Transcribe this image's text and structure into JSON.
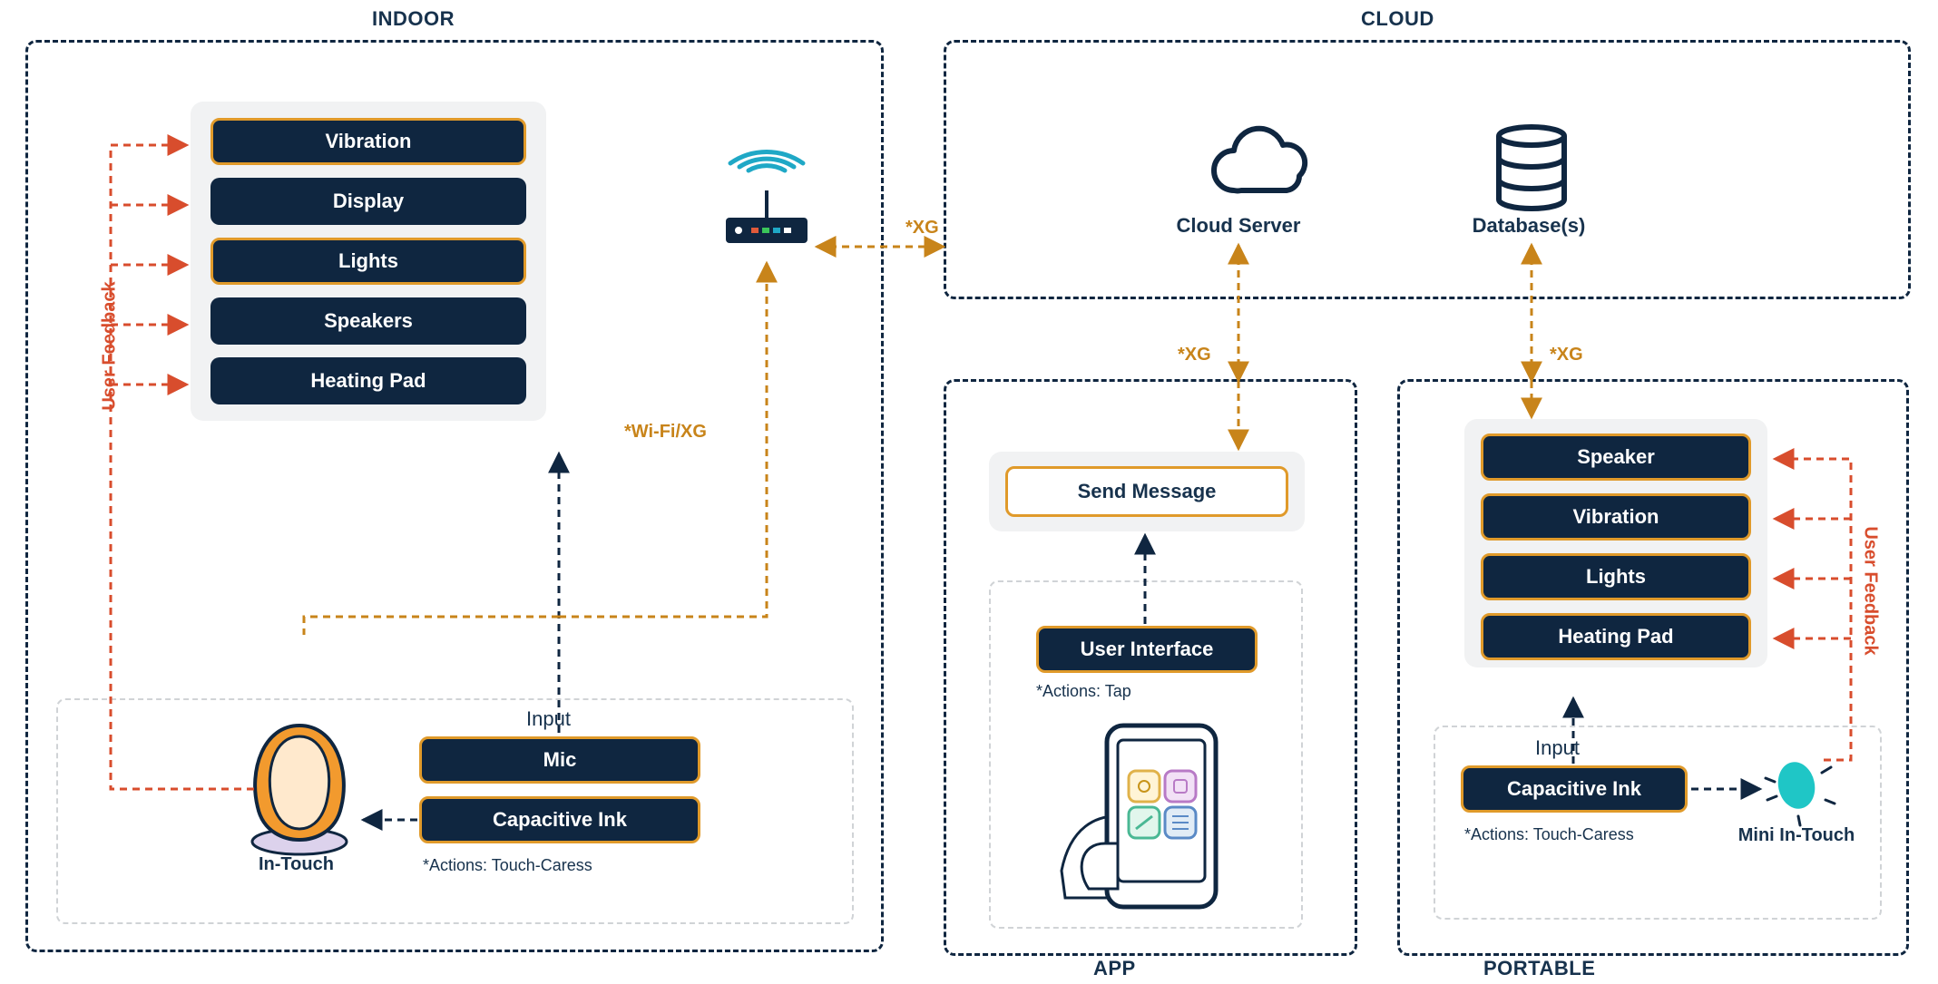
{
  "sections": {
    "indoor": "INDOOR",
    "cloud": "CLOUD",
    "app": "APP",
    "portable": "PORTABLE"
  },
  "indoor": {
    "outputs": [
      "Vibration",
      "Display",
      "Lights",
      "Speakers",
      "Heating Pad"
    ],
    "input_title": "Input",
    "inputs": [
      "Mic",
      "Capacitive Ink"
    ],
    "device_label": "In-Touch",
    "actions_note": "*Actions: Touch-Caress",
    "wifi_label": "*Wi-Fi/XG",
    "feedback_label": "User Feedback"
  },
  "cloud": {
    "server_label": "Cloud Server",
    "db_label": "Database(s)",
    "xg_to_router": "*XG",
    "xg_to_app": "*XG",
    "xg_to_portable": "*XG"
  },
  "app": {
    "send_msg": "Send Message",
    "ui_label": "User Interface",
    "actions_note": "*Actions: Tap"
  },
  "portable": {
    "outputs": [
      "Speaker",
      "Vibration",
      "Lights",
      "Heating Pad"
    ],
    "input_title": "Input",
    "inputs": [
      "Capacitive Ink"
    ],
    "device_label": "Mini In-Touch",
    "actions_note": "*Actions: Touch-Caress",
    "feedback_label": "User Feedback"
  }
}
